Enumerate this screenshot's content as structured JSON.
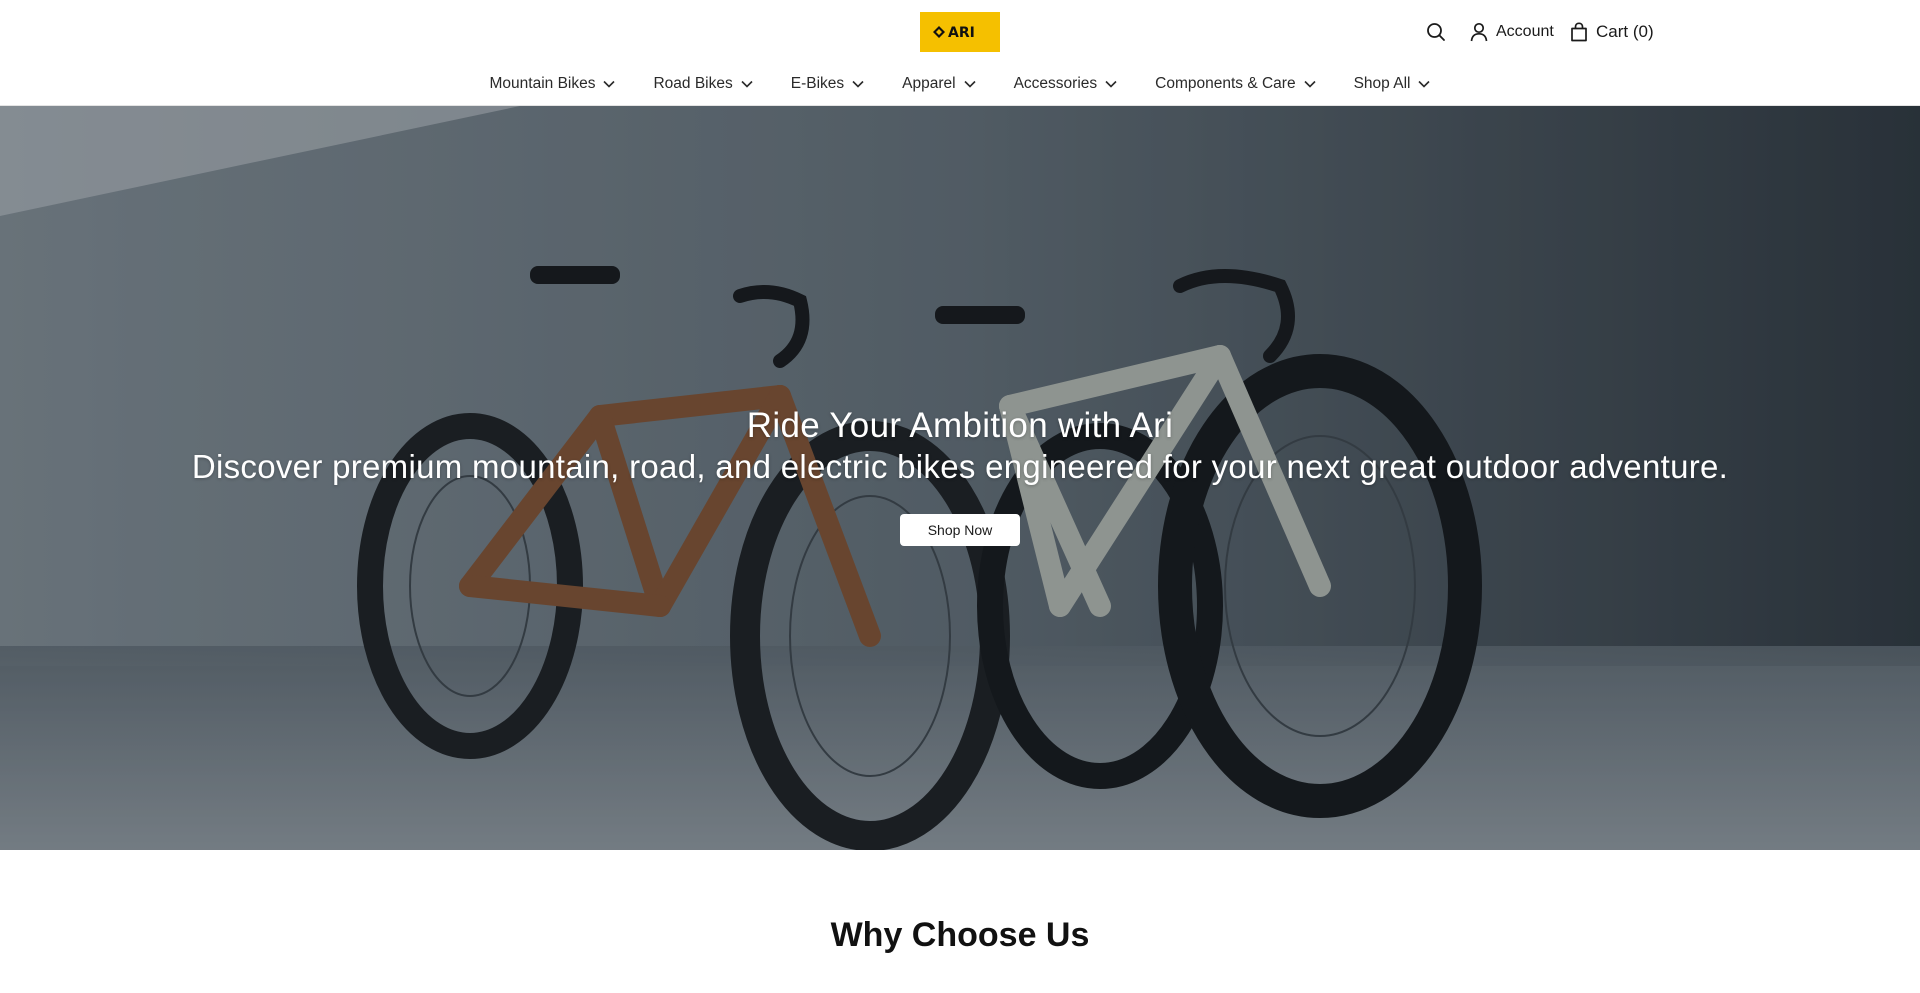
{
  "brand": {
    "logo_text": "ARI",
    "logo_color": "#f5c000"
  },
  "header": {
    "account_label": "Account",
    "cart_label": "Cart (0)"
  },
  "icons": {
    "search": "search-icon",
    "account": "user-icon",
    "cart": "shopping-bag-icon",
    "dropdown": "chevron-down-icon"
  },
  "nav": {
    "items": [
      {
        "label": "Mountain Bikes"
      },
      {
        "label": "Road Bikes"
      },
      {
        "label": "E-Bikes"
      },
      {
        "label": "Apparel"
      },
      {
        "label": "Accessories"
      },
      {
        "label": "Components & Care"
      },
      {
        "label": "Shop All"
      }
    ]
  },
  "hero": {
    "title": "Ride Your Ambition with Ari",
    "subtitle": "Discover premium mountain, road, and electric bikes engineered for your next great outdoor adventure.",
    "cta_label": "Shop Now"
  },
  "sections": {
    "why_title": "Why Choose Us"
  }
}
